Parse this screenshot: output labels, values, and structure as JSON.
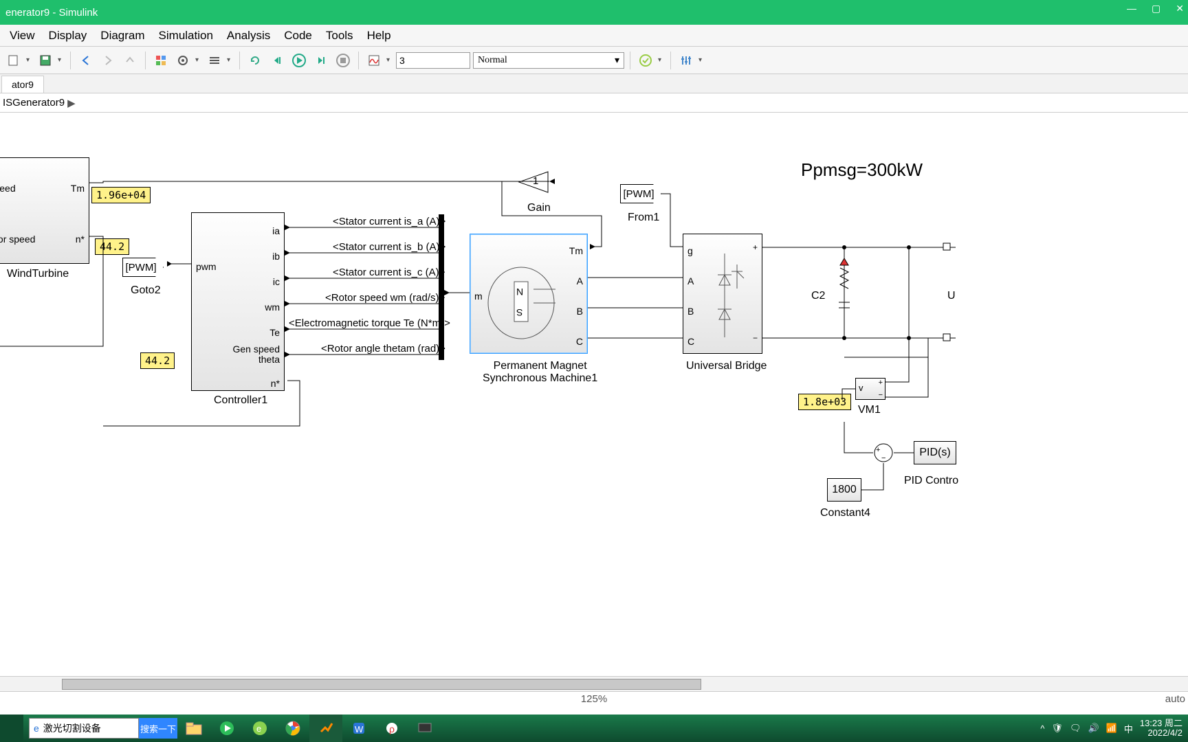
{
  "window": {
    "title": "enerator9 - Simulink",
    "min": "—",
    "max": "▢",
    "close": "✕"
  },
  "menu": [
    "View",
    "Display",
    "Diagram",
    "Simulation",
    "Analysis",
    "Code",
    "Tools",
    "Help"
  ],
  "toolbar": {
    "stop_time": "3",
    "mode": "Normal"
  },
  "tab": {
    "name": "ator9"
  },
  "crumb": {
    "path": "ISGenerator9",
    "arrow": "▶"
  },
  "annot": {
    "text": "Ppmsg=300kW"
  },
  "display": {
    "tm": "1.96e+04",
    "nstar": "44.2",
    "genspeed": "44.2",
    "vm": "1.8e+03"
  },
  "blocks": {
    "windturbine": {
      "name": "WindTurbine",
      "p_in1": "nd speed",
      "p_in2": "nerator speed",
      "p_out1": "Tm",
      "p_out2": "n*"
    },
    "goto2": {
      "name": "Goto2",
      "tag": "[PWM]"
    },
    "from1": {
      "name": "From1",
      "tag": "[PWM]"
    },
    "controller": {
      "name": "Controller1",
      "in": [
        "ia",
        "ib",
        "ic",
        "wm",
        "Te",
        "Gen speed",
        "theta",
        "n*"
      ],
      "out": "pwm"
    },
    "gain": {
      "name": "Gain",
      "value": "-1"
    },
    "pmsm": {
      "name": "Permanent Magnet\nSynchronous Machine1",
      "p_tm": "Tm",
      "p_m": "m",
      "p_a": "A",
      "p_b": "B",
      "p_c": "C",
      "rotor_n": "N",
      "rotor_s": "S"
    },
    "bridge": {
      "name": "Universal Bridge",
      "p_g": "g",
      "p_a": "A",
      "p_b": "B",
      "p_c": "C"
    },
    "c2": {
      "name": "C2"
    },
    "u_right": {
      "name": "U"
    },
    "vm1": {
      "name": "VM1",
      "v": "v"
    },
    "constant4": {
      "name": "Constant4",
      "value": "1800"
    },
    "pid": {
      "name": "PID Contro",
      "label": "PID(s)"
    }
  },
  "signals": [
    "<Stator current is_a (A)>",
    "<Stator current is_b (A)>",
    "<Stator current is_c (A)>",
    "<Rotor speed wm (rad/s)>",
    "<Electromagnetic torque Te (N*m)>",
    "<Rotor angle thetam (rad)>"
  ],
  "status": {
    "zoom": "125%",
    "right": "auto"
  },
  "taskbar": {
    "search_placeholder": "激光切割设备",
    "search_btn": "搜索一下",
    "tray_ime": "中",
    "clock_time": "13:23 周二",
    "clock_date": "2022/4/2"
  }
}
